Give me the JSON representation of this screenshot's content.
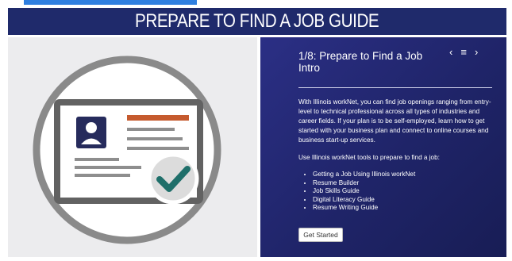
{
  "header": {
    "title": "PREPARE TO FIND A JOB GUIDE"
  },
  "slide": {
    "title": "1/8: Prepare to Find a Job Intro",
    "nav": {
      "prev": "‹",
      "menu": "≡",
      "next": "›"
    },
    "description": "With Illinois workNet, you can find job openings ranging from entry-level to technical professional across all types of industries and career fields. If your plan is to be self-employed, learn how to get started with your business plan and connect to online courses and business start-up services.",
    "use_text": "Use Illinois workNet tools to prepare to find a job:",
    "links": [
      "Getting a Job Using Illinois workNet",
      "Resume Builder",
      "Job Skills Guide",
      "Digital Literacy Guide",
      "Resume Writing Guide"
    ],
    "button_label": "Get Started"
  },
  "colors": {
    "header_bg": "#1f2a6b",
    "panel_bg": "#20266b",
    "accent_orange": "#c55a2e",
    "check_teal": "#1f6f6a",
    "top_accent": "#2f7fe0"
  },
  "illustration": {
    "icon": "id-card-checkmark-icon"
  }
}
